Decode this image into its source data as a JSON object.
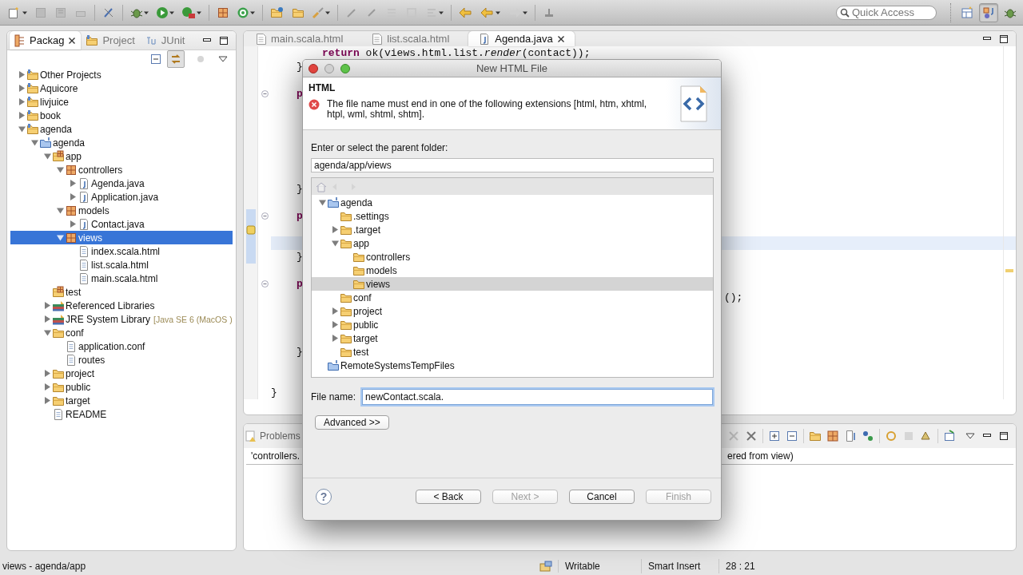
{
  "toolbar": {
    "quick_access": {
      "placeholder": "Quick Access"
    },
    "perspectives": [
      {
        "selected": false
      },
      {
        "selected": true
      },
      {
        "selected": false
      }
    ]
  },
  "package_explorer": {
    "tabs": [
      {
        "label": "Packag",
        "kind": "packages",
        "selected": true
      },
      {
        "label": "Project",
        "kind": "project",
        "selected": false
      },
      {
        "label": "JUnit",
        "kind": "junit",
        "selected": false
      }
    ],
    "tree": [
      {
        "label": "Other Projects",
        "kind": "project",
        "expanded": false,
        "selected": false
      },
      {
        "label": "Aquicore",
        "kind": "project",
        "expanded": false,
        "selected": false
      },
      {
        "label": "livjuice",
        "kind": "project",
        "expanded": false,
        "selected": false
      },
      {
        "label": "book",
        "kind": "project",
        "expanded": false,
        "selected": false
      },
      {
        "label": "agenda",
        "kind": "project",
        "expanded": true,
        "selected": false,
        "children": [
          {
            "label": "agenda",
            "kind": "java-project",
            "expanded": true,
            "selected": false,
            "children": [
              {
                "label": "app",
                "kind": "source-folder",
                "expanded": true,
                "selected": false,
                "children": [
                  {
                    "label": "controllers",
                    "kind": "package",
                    "expanded": true,
                    "selected": false,
                    "children": [
                      {
                        "label": "Agenda.java",
                        "kind": "java",
                        "expanded": false,
                        "selected": false
                      },
                      {
                        "label": "Application.java",
                        "kind": "java",
                        "expanded": false,
                        "selected": false
                      }
                    ]
                  },
                  {
                    "label": "models",
                    "kind": "package",
                    "expanded": true,
                    "selected": false,
                    "children": [
                      {
                        "label": "Contact.java",
                        "kind": "java",
                        "expanded": false,
                        "selected": false
                      }
                    ]
                  },
                  {
                    "label": "views",
                    "kind": "package",
                    "expanded": true,
                    "selected": true,
                    "children": [
                      {
                        "label": "index.scala.html",
                        "kind": "file",
                        "selected": false
                      },
                      {
                        "label": "list.scala.html",
                        "kind": "file",
                        "selected": false
                      },
                      {
                        "label": "main.scala.html",
                        "kind": "file",
                        "selected": false
                      }
                    ]
                  }
                ]
              },
              {
                "label": "test",
                "kind": "source-folder",
                "selected": false
              },
              {
                "label": "Referenced Libraries",
                "kind": "library",
                "expanded": false,
                "selected": false
              },
              {
                "label": "JRE System Library",
                "decoration": "[Java SE 6 (MacOS )",
                "kind": "library",
                "expanded": false,
                "selected": false
              },
              {
                "label": "conf",
                "kind": "folder",
                "expanded": true,
                "selected": false,
                "children": [
                  {
                    "label": "application.conf",
                    "kind": "file",
                    "selected": false
                  },
                  {
                    "label": "routes",
                    "kind": "file",
                    "selected": false
                  }
                ]
              },
              {
                "label": "project",
                "kind": "folder",
                "expanded": false,
                "selected": false
              },
              {
                "label": "public",
                "kind": "folder",
                "expanded": false,
                "selected": false
              },
              {
                "label": "target",
                "kind": "folder",
                "expanded": false,
                "selected": false
              },
              {
                "label": "README",
                "kind": "file",
                "selected": false
              }
            ]
          }
        ]
      }
    ]
  },
  "editor": {
    "tabs": [
      {
        "label": "main.scala.html",
        "kind": "html",
        "selected": false
      },
      {
        "label": "list.scala.html",
        "kind": "html",
        "selected": false
      },
      {
        "label": "Agenda.java",
        "kind": "java",
        "selected": true
      }
    ],
    "code_lines": [
      {
        "text": "**return** ok(views.html.list.*render*(contact));",
        "kind": "code"
      },
      {
        "text": "}",
        "kind": "code"
      },
      {
        "text": "p",
        "kind": "keyword"
      },
      {
        "text": "}",
        "kind": "code"
      },
      {
        "text": "p",
        "kind": "keyword"
      },
      {
        "text": "}",
        "kind": "code"
      },
      {
        "text": "p",
        "kind": "keyword"
      },
      {
        "text": "();",
        "kind": "code"
      },
      {
        "text": "}",
        "kind": "code"
      },
      {
        "text": "}",
        "kind": "code"
      }
    ]
  },
  "problems": {
    "tab": {
      "label": "Problems"
    },
    "row": [
      "'controllers.",
      "ered from view)"
    ]
  },
  "dialog": {
    "title": "New HTML File",
    "header": "HTML",
    "error": "The file name must end in one of the following extensions [html, htm, xhtml, htpl, wml, shtml, shtm].",
    "folder_label": "Enter or select the parent folder:",
    "folder_value": "agenda/app/views",
    "folder_tree": [
      {
        "label": "agenda",
        "kind": "java-project",
        "expanded": true,
        "selected": false,
        "children": [
          {
            "label": ".settings",
            "kind": "folder",
            "selected": false
          },
          {
            "label": ".target",
            "kind": "folder",
            "expanded": false,
            "selected": false
          },
          {
            "label": "app",
            "kind": "folder",
            "expanded": true,
            "selected": false,
            "children": [
              {
                "label": "controllers",
                "kind": "folder",
                "selected": false
              },
              {
                "label": "models",
                "kind": "folder",
                "selected": false
              },
              {
                "label": "views",
                "kind": "folder",
                "selected": true
              }
            ]
          },
          {
            "label": "conf",
            "kind": "folder",
            "selected": false
          },
          {
            "label": "project",
            "kind": "folder",
            "expanded": false,
            "selected": false
          },
          {
            "label": "public",
            "kind": "folder",
            "expanded": false,
            "selected": false
          },
          {
            "label": "target",
            "kind": "folder",
            "expanded": false,
            "selected": false
          },
          {
            "label": "test",
            "kind": "folder",
            "selected": false
          }
        ]
      },
      {
        "label": "RemoteSystemsTempFiles",
        "kind": "java-project",
        "selected": false
      }
    ],
    "file_name_label": "File name:",
    "file_name_value": "newContact.scala.",
    "advanced_button": "Advanced >>",
    "help": "?",
    "buttons": [
      {
        "label": "< Back",
        "disabled": false
      },
      {
        "label": "Next >",
        "disabled": true
      },
      {
        "label": "Cancel",
        "disabled": false
      },
      {
        "label": "Finish",
        "disabled": true
      }
    ]
  },
  "status_bar": {
    "selection": "views - agenda/app",
    "mode": "Writable",
    "insert_mode": "Smart Insert",
    "position": "28 : 21"
  }
}
